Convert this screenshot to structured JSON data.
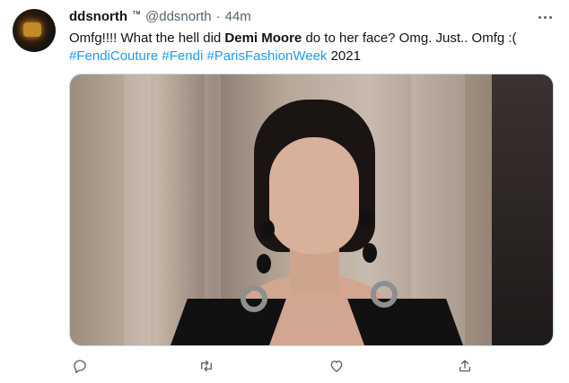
{
  "tweet": {
    "display_name": "ddsnorth",
    "name_suffix": "™",
    "handle": "@ddsnorth",
    "separator": "·",
    "time": "44m",
    "text": {
      "part1": "Omfg!!!! What the hell did ",
      "bold": "Demi Moore",
      "part2": " do to her face?  Omg. Just.. Omfg :(",
      "hashtags": [
        "#FendiCouture",
        "#Fendi",
        "#ParisFashionWeek"
      ],
      "year": "2021"
    }
  },
  "actions": {
    "reply_icon": "reply-icon",
    "retweet_icon": "retweet-icon",
    "like_icon": "heart-icon",
    "share_icon": "share-icon"
  },
  "colors": {
    "hashtag": "#1d9bf0",
    "muted": "#536471",
    "text": "#0f1419"
  }
}
